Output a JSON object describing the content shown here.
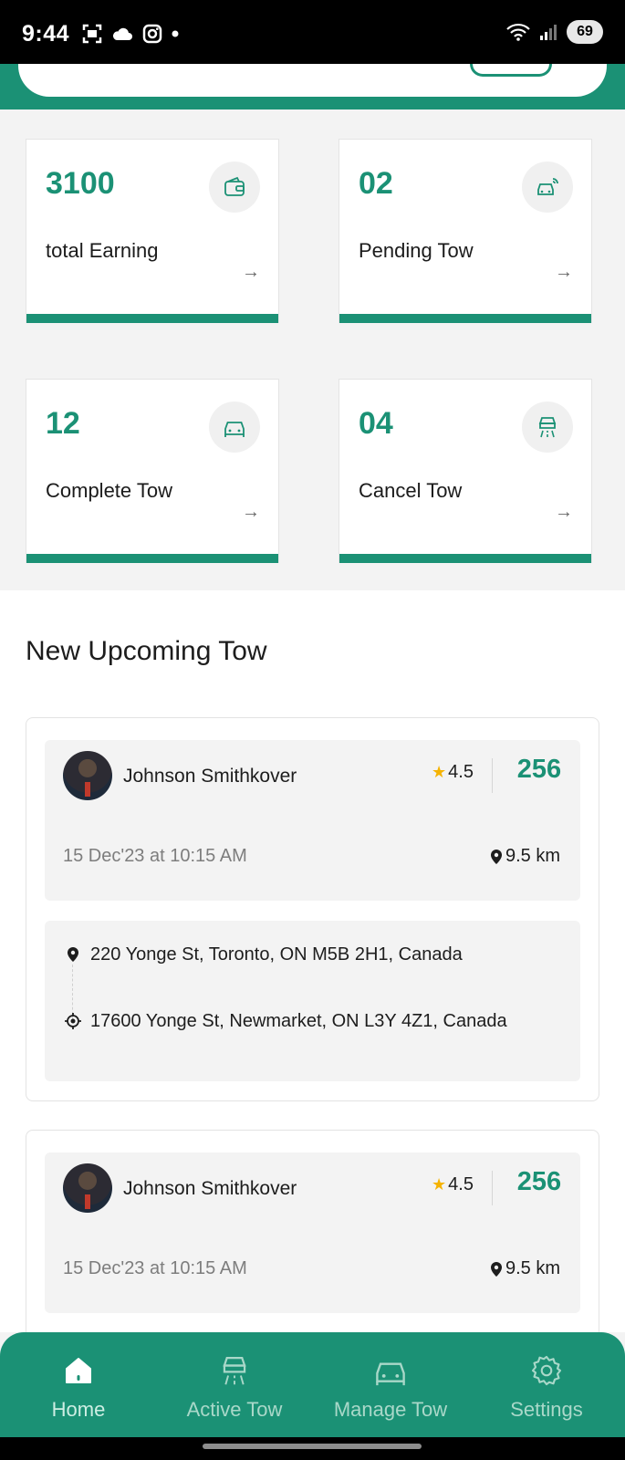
{
  "status_bar": {
    "time": "9:44",
    "battery": "69"
  },
  "colors": {
    "accent": "#1b9175",
    "card_bg": "#f3f3f3",
    "star": "#f5b301"
  },
  "stats": [
    {
      "value": "3100",
      "label": "total Earning",
      "icon": "wallet-icon"
    },
    {
      "value": "02",
      "label": "Pending Tow",
      "icon": "signal-car-icon"
    },
    {
      "value": "12",
      "label": "Complete Tow",
      "icon": "car-icon"
    },
    {
      "value": "04",
      "label": "Cancel Tow",
      "icon": "car-road-icon"
    }
  ],
  "upcoming": {
    "title": "New Upcoming Tow",
    "tows": [
      {
        "name": "Johnson Smithkover",
        "rating": "4.5",
        "price": "256",
        "date": "15 Dec'23 at 10:15 AM",
        "distance": "9.5 km",
        "pickup": "220 Yonge St, Toronto, ON M5B 2H1, Canada",
        "dropoff": "17600 Yonge St, Newmarket, ON L3Y 4Z1, Canada"
      },
      {
        "name": "Johnson Smithkover",
        "rating": "4.5",
        "price": "256",
        "date": "15 Dec'23 at 10:15 AM",
        "distance": "9.5 km"
      }
    ]
  },
  "nav": {
    "active": "Home",
    "items": [
      {
        "label": "Home",
        "icon": "home-icon"
      },
      {
        "label": "Active Tow",
        "icon": "car-road-icon"
      },
      {
        "label": "Manage Tow",
        "icon": "car-icon"
      },
      {
        "label": "Settings",
        "icon": "gear-icon"
      }
    ]
  }
}
